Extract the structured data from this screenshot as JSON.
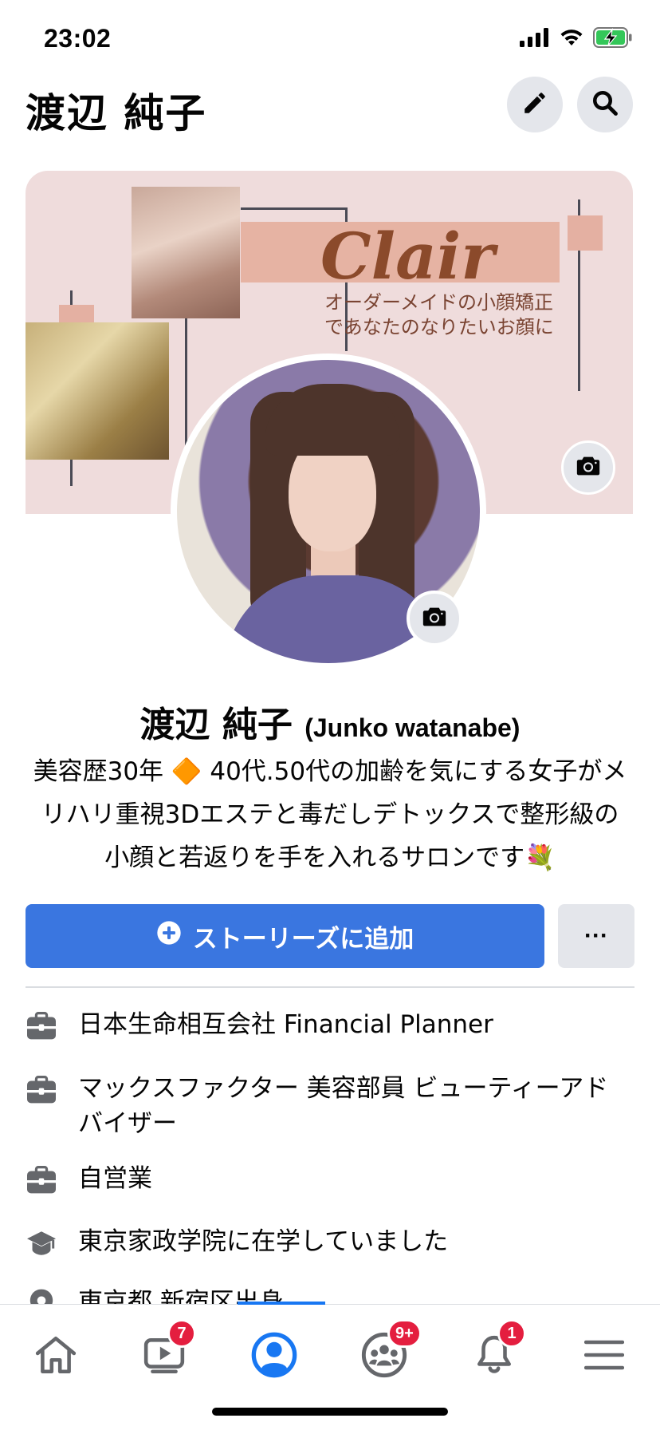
{
  "status_bar": {
    "time": "23:02"
  },
  "header": {
    "title": "渡辺 純子"
  },
  "cover": {
    "brand": "Clair",
    "tagline_line1": "オーダーメイドの小顔矯正",
    "tagline_line2": "であなたのなりたいお顔に"
  },
  "profile": {
    "name": "渡辺 純子",
    "alt_name": "(Junko watanabe)",
    "bio_line1": "美容歴30年 🔶 40代.50代の加齢を気にする女子がメ",
    "bio_line2": "リハリ重視3Dエステと毒だしデトックスで整形級の",
    "bio_line3": "小顔と若返りを手を入れるサロンです💐"
  },
  "actions": {
    "add_story_label": "ストーリーズに追加",
    "more_label": "···"
  },
  "details": [
    {
      "icon": "briefcase-icon",
      "text": "日本生命相互会社 Financial Planner"
    },
    {
      "icon": "briefcase-icon",
      "text": "マックスファクター 美容部員 ビューティーアドバイザー"
    },
    {
      "icon": "briefcase-icon",
      "text": "自営業"
    },
    {
      "icon": "graduation-cap-icon",
      "text": "東京家政学院に在学していました"
    },
    {
      "icon": "location-pin-icon",
      "text": "東京都 新宿区出身"
    }
  ],
  "bottom_nav": {
    "items": [
      {
        "name": "home",
        "badge": ""
      },
      {
        "name": "watch",
        "badge": "7"
      },
      {
        "name": "profile",
        "badge": ""
      },
      {
        "name": "groups",
        "badge": "9+"
      },
      {
        "name": "notifications",
        "badge": "1"
      },
      {
        "name": "menu",
        "badge": ""
      }
    ]
  },
  "colors": {
    "primary_blue": "#3a76e0",
    "active_blue": "#1877f2",
    "badge_red": "#e41e3f",
    "button_gray": "#e4e6eb",
    "cover_pink": "#efdcdc"
  }
}
